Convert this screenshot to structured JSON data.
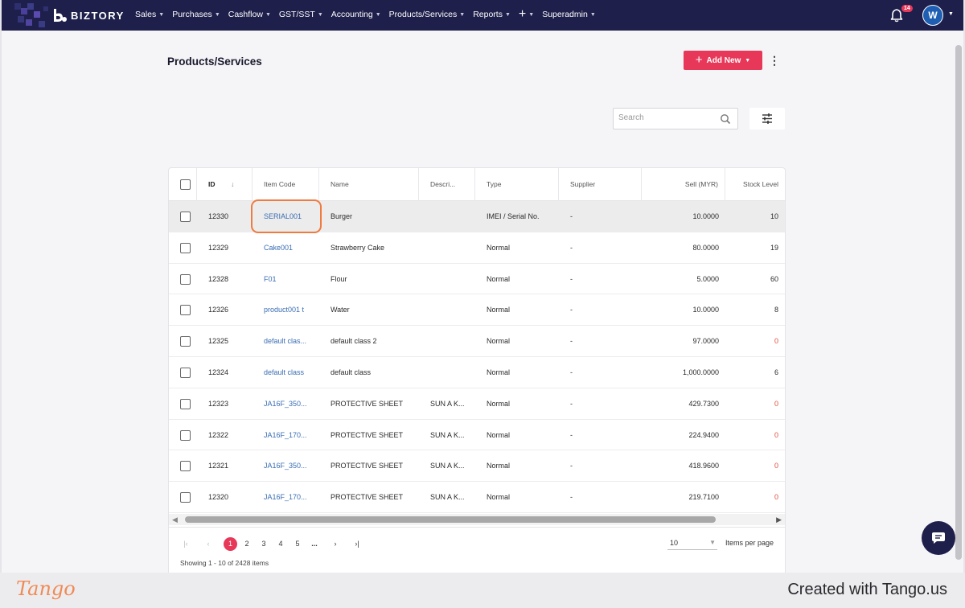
{
  "app": {
    "name": "BIZTORY"
  },
  "nav": {
    "items": [
      {
        "label": "Sales"
      },
      {
        "label": "Purchases"
      },
      {
        "label": "Cashflow"
      },
      {
        "label": "GST/SST"
      },
      {
        "label": "Accounting"
      },
      {
        "label": "Products/Services"
      },
      {
        "label": "Reports"
      },
      {
        "label": "+"
      },
      {
        "label": "Superadmin"
      }
    ],
    "notification_count": "14",
    "avatar_initial": "W"
  },
  "page": {
    "title": "Products/Services",
    "add_button": "Add New",
    "search_placeholder": "Search"
  },
  "table": {
    "columns": [
      "ID",
      "Item Code",
      "Name",
      "Descri...",
      "Type",
      "Supplier",
      "Sell (MYR)",
      "Stock Level"
    ],
    "rows": [
      {
        "id": "12330",
        "code": "SERIAL001",
        "name": "Burger",
        "desc": "",
        "type": "IMEI / Serial No.",
        "supplier": "-",
        "sell": "10.0000",
        "stock": "10",
        "selected": true
      },
      {
        "id": "12329",
        "code": "Cake001",
        "name": "Strawberry Cake",
        "desc": "",
        "type": "Normal",
        "supplier": "-",
        "sell": "80.0000",
        "stock": "19"
      },
      {
        "id": "12328",
        "code": "F01",
        "name": "Flour",
        "desc": "",
        "type": "Normal",
        "supplier": "-",
        "sell": "5.0000",
        "stock": "60"
      },
      {
        "id": "12326",
        "code": "product001 t",
        "name": "Water",
        "desc": "",
        "type": "Normal",
        "supplier": "-",
        "sell": "10.0000",
        "stock": "8"
      },
      {
        "id": "12325",
        "code": "default clas...",
        "name": "default class 2",
        "desc": "",
        "type": "Normal",
        "supplier": "-",
        "sell": "97.0000",
        "stock": "0"
      },
      {
        "id": "12324",
        "code": "default class",
        "name": "default class",
        "desc": "",
        "type": "Normal",
        "supplier": "-",
        "sell": "1,000.0000",
        "stock": "6"
      },
      {
        "id": "12323",
        "code": "JA16F_350...",
        "name": "PROTECTIVE SHEET",
        "desc": "SUN A K...",
        "type": "Normal",
        "supplier": "-",
        "sell": "429.7300",
        "stock": "0"
      },
      {
        "id": "12322",
        "code": "JA16F_170...",
        "name": "PROTECTIVE SHEET",
        "desc": "SUN A K...",
        "type": "Normal",
        "supplier": "-",
        "sell": "224.9400",
        "stock": "0"
      },
      {
        "id": "12321",
        "code": "JA16F_350...",
        "name": "PROTECTIVE SHEET",
        "desc": "SUN A K...",
        "type": "Normal",
        "supplier": "-",
        "sell": "418.9600",
        "stock": "0"
      },
      {
        "id": "12320",
        "code": "JA16F_170...",
        "name": "PROTECTIVE SHEET",
        "desc": "SUN A K...",
        "type": "Normal",
        "supplier": "-",
        "sell": "219.7100",
        "stock": "0"
      }
    ]
  },
  "pagination": {
    "pages": [
      "1",
      "2",
      "3",
      "4",
      "5",
      "..."
    ],
    "current": "1",
    "per_page": "10",
    "per_page_label": "Items per page",
    "showing": "Showing 1 - 10 of 2428 items"
  },
  "footer": {
    "brand": "Tango",
    "created": "Created with Tango.us"
  },
  "colors": {
    "nav": "#1e1f4b",
    "accent": "#e8385a",
    "highlight": "#f07a3f",
    "link": "#3a6db3"
  }
}
